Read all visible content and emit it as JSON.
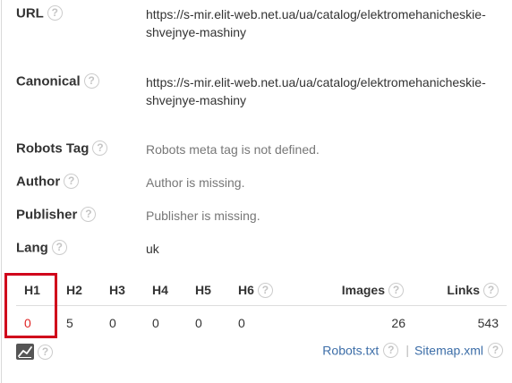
{
  "meta": {
    "url": {
      "label": "URL",
      "value": "https://s-mir.elit-web.net.ua/ua/catalog/elektromehanicheskie-shvejnye-mashiny"
    },
    "canonical": {
      "label": "Canonical",
      "value": "https://s-mir.elit-web.net.ua/ua/catalog/elektromehanicheskie-shvejnye-mashiny"
    },
    "robots_tag": {
      "label": "Robots Tag",
      "value": "Robots meta tag is not defined."
    },
    "author": {
      "label": "Author",
      "value": "Author is missing."
    },
    "publisher": {
      "label": "Publisher",
      "value": "Publisher is missing."
    },
    "lang": {
      "label": "Lang",
      "value": "uk"
    }
  },
  "headings": {
    "columns": [
      "H1",
      "H2",
      "H3",
      "H4",
      "H5",
      "H6",
      "Images",
      "Links"
    ],
    "values": [
      "0",
      "5",
      "0",
      "0",
      "0",
      "0",
      "26",
      "543"
    ]
  },
  "help_glyph": "?",
  "footer": {
    "robots_link": "Robots.txt",
    "separator": "|",
    "sitemap_link": "Sitemap.xml"
  },
  "icons": {
    "help": "question-circle-icon",
    "chart": "line-chart-icon"
  },
  "colors": {
    "accent_link": "#3d6ea8",
    "highlight": "#d0021b",
    "warning_value": "#e02424"
  }
}
